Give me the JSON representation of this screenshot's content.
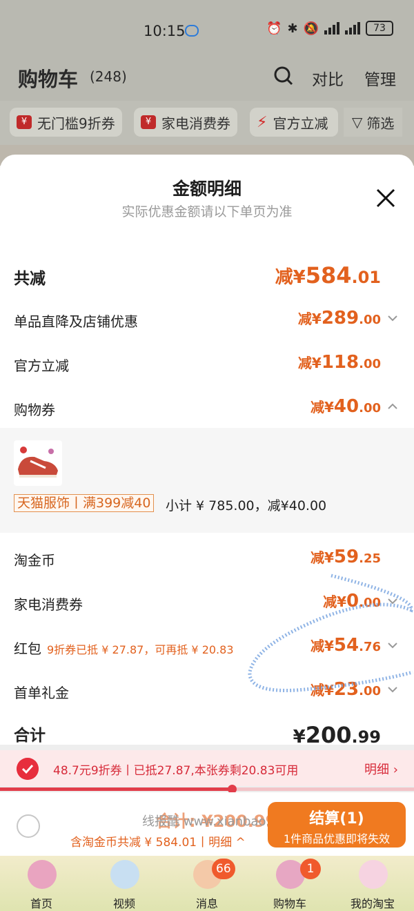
{
  "status_bar": {
    "time": "10:15",
    "battery": "73"
  },
  "header": {
    "title": "购物车",
    "count": "(248)",
    "compare": "对比",
    "manage": "管理"
  },
  "chips": [
    "无门槛9折券",
    "家电消费券",
    "官方立减",
    "筛选"
  ],
  "sheet": {
    "title": "金额明细",
    "subtitle": "实际优惠金额请以下单页为准",
    "total_reduction": {
      "label": "共减",
      "prefix": "减¥",
      "main": "584",
      "decimal": ".01"
    },
    "rows": [
      {
        "label": "单品直降及店铺优惠",
        "prefix": "减¥",
        "main": "289",
        "decimal": ".00"
      },
      {
        "label": "官方立减",
        "prefix": "减¥",
        "main": "118",
        "decimal": ".00"
      },
      {
        "label": "购物券",
        "prefix": "减¥",
        "main": "40",
        "decimal": ".00"
      }
    ],
    "voucher_detail": {
      "shop_tag": "天猫服饰丨满399减40",
      "subtotal": "小计 ¥ 785.00，减¥40.00"
    },
    "rows2": [
      {
        "label": "淘金币",
        "prefix": "减¥",
        "main": "59",
        "decimal": ".25"
      },
      {
        "label": "家电消费券",
        "prefix": "减¥",
        "main": "0",
        "decimal": ".00"
      },
      {
        "label": "红包",
        "note": "9折券已抵 ¥ 27.87，可再抵 ¥ 20.83",
        "prefix": "减¥",
        "main": "54",
        "decimal": ".76"
      },
      {
        "label": "首单礼金",
        "prefix": "减¥",
        "main": "23",
        "decimal": ".00"
      }
    ],
    "grand_total": {
      "label": "合计",
      "prefix": "¥",
      "main": "200",
      "decimal": ".99"
    }
  },
  "coupon_bar": {
    "text": "48.7元9折券丨已抵27.87,本张券剩20.83可用",
    "detail": "明细 ›",
    "used_fraction": 0.56
  },
  "checkout": {
    "total": "合计: ¥200.99",
    "watermark": "线报酷 www.xianbao.fun",
    "discount_note": "含淘金币共减 ¥ 584.01丨明细 ^",
    "button_main": "结算(1)",
    "button_sub": "1件商品优惠即将失效"
  },
  "tabs": [
    {
      "label": "首页",
      "color": "#e9a4c0"
    },
    {
      "label": "视频",
      "color": "#c8dff2"
    },
    {
      "label": "消息",
      "badge": "66",
      "color": "#f4c9a8"
    },
    {
      "label": "购物车",
      "badge": "1",
      "color": "#e7a7c3"
    },
    {
      "label": "我的淘宝",
      "color": "#f6d3e1"
    }
  ],
  "colors": {
    "accent": "#e2611e",
    "coupon_red": "#e72e3d",
    "checkout_orange": "#f07a20"
  }
}
